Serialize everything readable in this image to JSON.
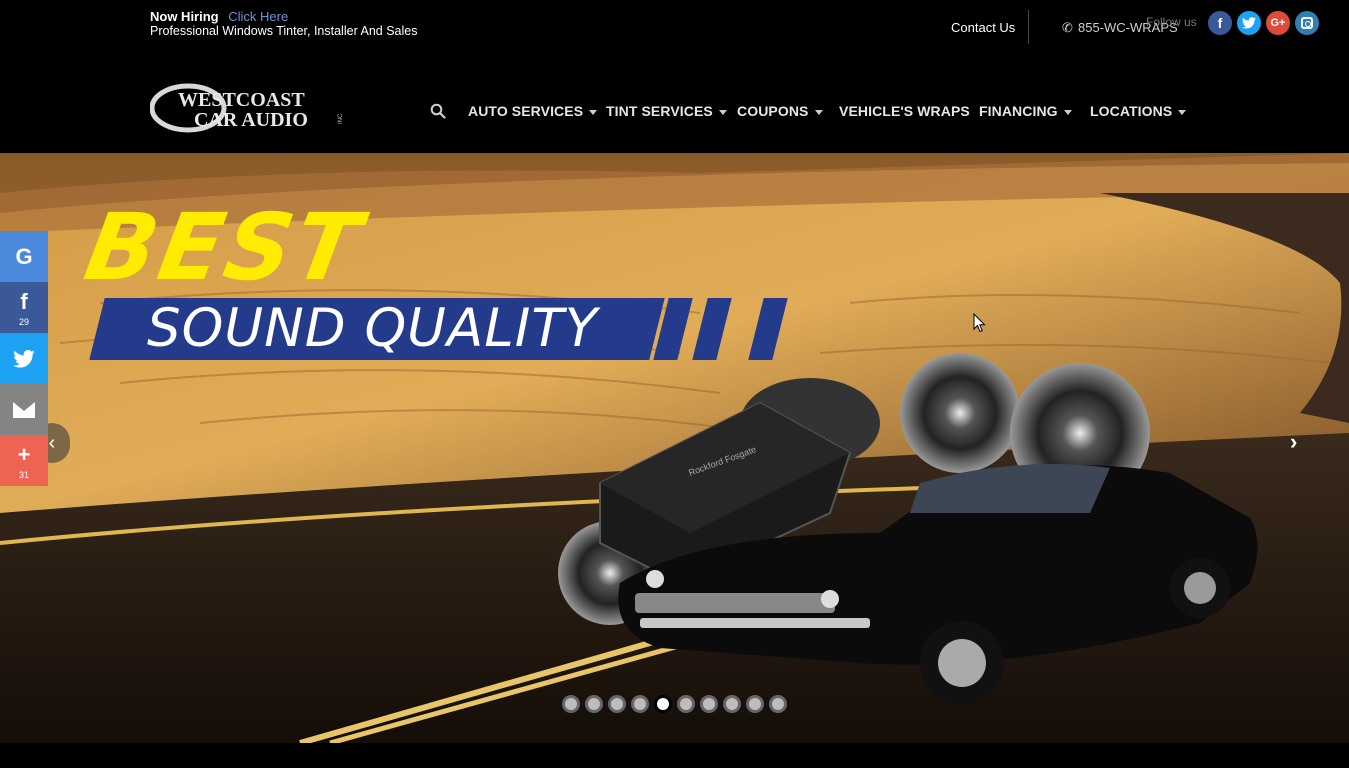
{
  "topbar": {
    "hiring_label": "Now Hiring",
    "hiring_link": "Click Here",
    "hiring_sub": "Professional Windows Tinter, Installer And Sales",
    "contact": "Contact Us",
    "phone": "855-WC-WRAPS",
    "follow": "Follow us"
  },
  "logo": {
    "line1": "WESTCOAST",
    "line2": "CAR AUDIO",
    "suffix": "INC"
  },
  "nav": {
    "items": [
      {
        "label": "AUTO SERVICES",
        "dropdown": true
      },
      {
        "label": "TINT SERVICES",
        "dropdown": true
      },
      {
        "label": "COUPONS",
        "dropdown": true
      },
      {
        "label": "VEHICLE'S WRAPS",
        "dropdown": false
      },
      {
        "label": "FINANCING",
        "dropdown": true
      },
      {
        "label": "LOCATIONS",
        "dropdown": true
      }
    ]
  },
  "hero": {
    "headline": "BEST",
    "subheadline": "SOUND QUALITY",
    "amp_brand": "Rockford Fosgate",
    "slides_total": 10,
    "active_slide": 5
  },
  "share": {
    "facebook_count": "29",
    "more_count": "31"
  },
  "colors": {
    "headline_yellow": "#ffec00",
    "banner_blue": "#243b8c",
    "link_blue": "#6c93d8"
  }
}
